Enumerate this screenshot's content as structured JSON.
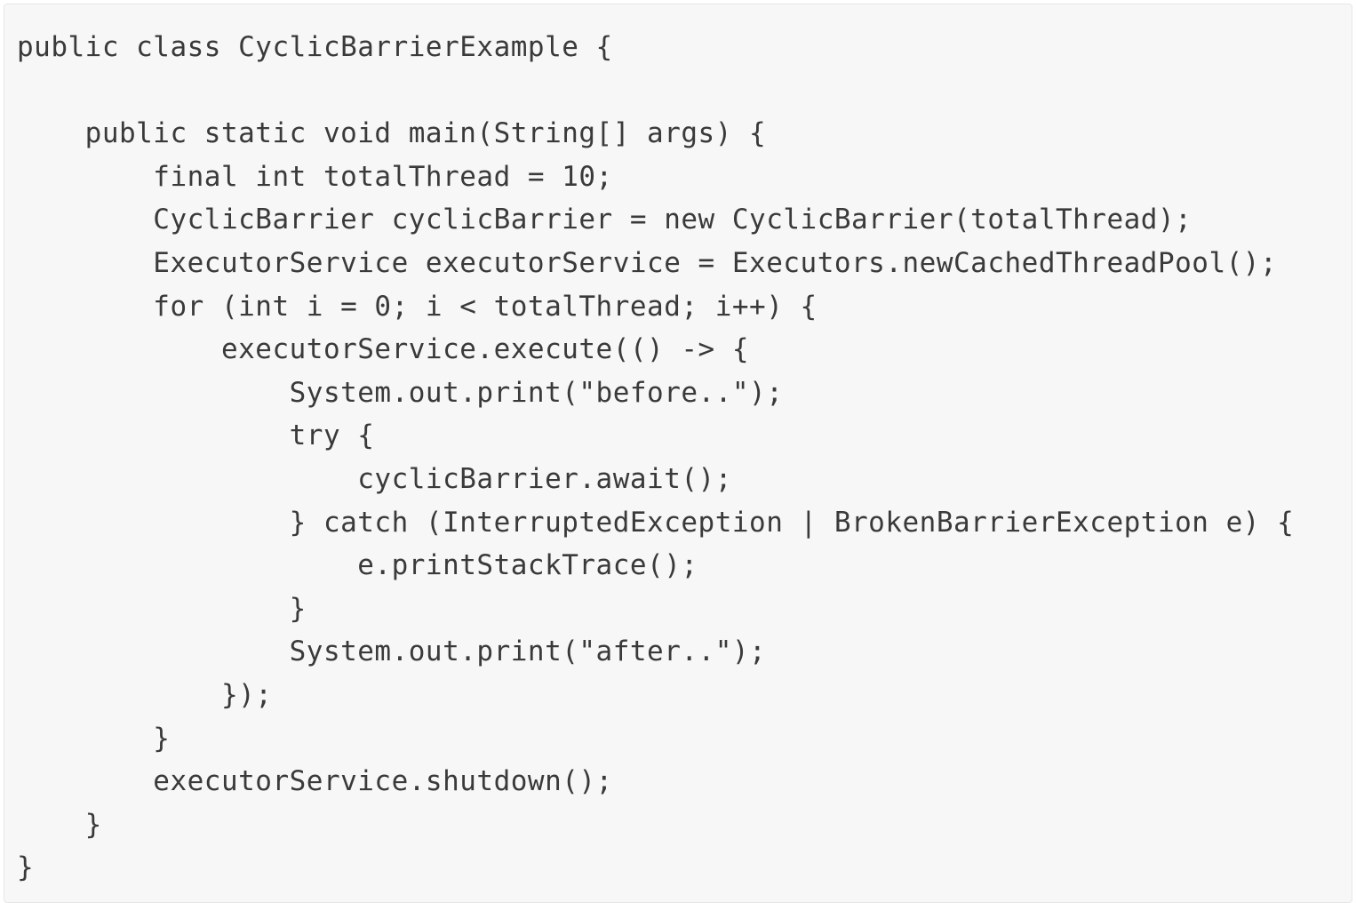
{
  "code": {
    "lines": [
      "public class CyclicBarrierExample {",
      "",
      "    public static void main(String[] args) {",
      "        final int totalThread = 10;",
      "        CyclicBarrier cyclicBarrier = new CyclicBarrier(totalThread);",
      "        ExecutorService executorService = Executors.newCachedThreadPool();",
      "        for (int i = 0; i < totalThread; i++) {",
      "            executorService.execute(() -> {",
      "                System.out.print(\"before..\");",
      "                try {",
      "                    cyclicBarrier.await();",
      "                } catch (InterruptedException | BrokenBarrierException e) {",
      "                    e.printStackTrace();",
      "                }",
      "                System.out.print(\"after..\");",
      "            });",
      "        }",
      "        executorService.shutdown();",
      "    }",
      "}"
    ]
  }
}
